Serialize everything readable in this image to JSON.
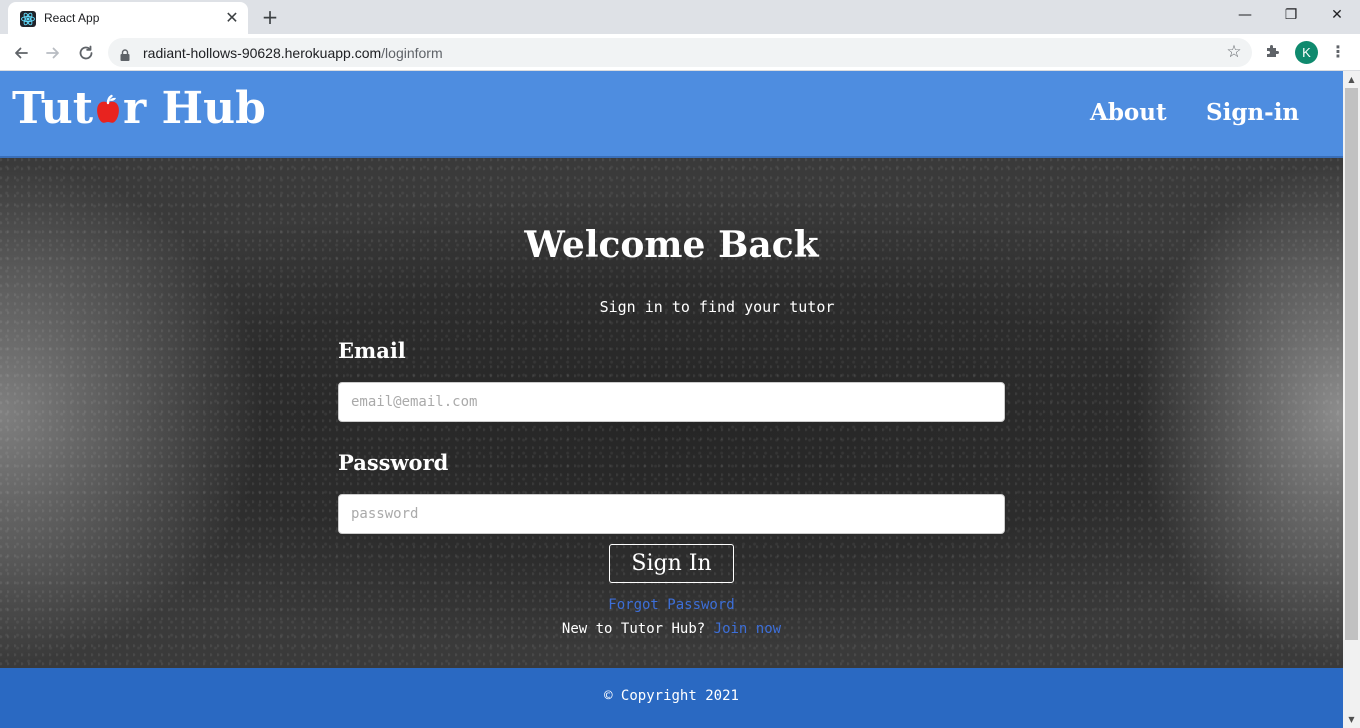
{
  "browser": {
    "tab_title": "React App",
    "tab_close_glyph": "✕",
    "new_tab_glyph": "+",
    "window_min_glyph": "—",
    "window_max_glyph": "❐",
    "window_close_glyph": "✕",
    "url_host": "radiant-hollows-90628.herokuapp.com",
    "url_path": "/loginform",
    "profile_initial": "K",
    "icons": {
      "back": "arrow-left-icon",
      "forward": "arrow-right-icon",
      "reload": "reload-icon",
      "lock": "lock-icon",
      "bookmark": "star-icon",
      "extensions": "puzzle-icon",
      "menu": "kebab-menu-icon"
    }
  },
  "header": {
    "logo_before": "Tut",
    "logo_after": "r Hub",
    "nav": {
      "about": "About",
      "signin": "Sign-in"
    },
    "colors": {
      "header_bg": "#4e8de0",
      "apple": "#e8231f"
    }
  },
  "login": {
    "title": "Welcome Back",
    "subtitle": "Sign in to find your tutor",
    "email_label": "Email",
    "email_placeholder": "email@email.com",
    "password_label": "Password",
    "password_placeholder": "password",
    "submit_label": "Sign In",
    "forgot_label": "Forgot Password",
    "join_prompt": "New to Tutor Hub?",
    "join_label": "Join now",
    "link_color": "#3d6fd8"
  },
  "footer": {
    "copyright": "© Copyright 2021",
    "footer_bg": "#2a69c2"
  }
}
